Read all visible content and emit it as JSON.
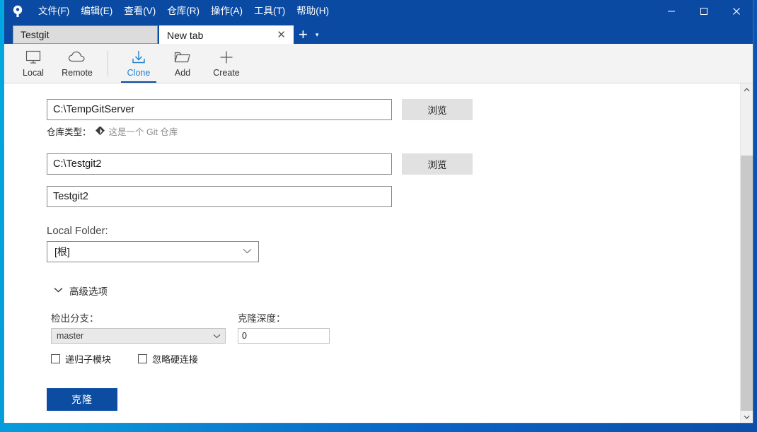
{
  "window": {
    "app_logo_icon": "smartgit-logo-icon",
    "menus": [
      {
        "label": "文件(F)",
        "name": "menu-file"
      },
      {
        "label": "编辑(E)",
        "name": "menu-edit"
      },
      {
        "label": "查看(V)",
        "name": "menu-view"
      },
      {
        "label": "仓库(R)",
        "name": "menu-repository"
      },
      {
        "label": "操作(A)",
        "name": "menu-actions"
      },
      {
        "label": "工具(T)",
        "name": "menu-tools"
      },
      {
        "label": "帮助(H)",
        "name": "menu-help"
      }
    ],
    "controls": {
      "minimize": "—",
      "maximize": "☐",
      "close": "✕"
    }
  },
  "tabs": {
    "items": [
      {
        "label": "Testgit",
        "active": false
      },
      {
        "label": "New tab",
        "active": true
      }
    ],
    "close_glyph": "✕",
    "new_tab_glyph": "+",
    "tab_menu_glyph": "▾"
  },
  "toolbar": {
    "buttons": [
      {
        "label": "Local",
        "icon": "monitor-icon",
        "selected": false
      },
      {
        "label": "Remote",
        "icon": "cloud-icon",
        "selected": false
      },
      {
        "label": "Clone",
        "icon": "download-arrow-icon",
        "selected": true
      },
      {
        "label": "Add",
        "icon": "folder-icon",
        "selected": false
      },
      {
        "label": "Create",
        "icon": "plus-icon",
        "selected": false
      }
    ]
  },
  "form": {
    "source": {
      "value": "C:\\TempGitServer",
      "placeholder": "",
      "browse_label": "浏览"
    },
    "repo_type": {
      "label": "仓库类型：",
      "icon": "git-diamond-icon",
      "hint": "这是一个 Git 仓库"
    },
    "target": {
      "value": "C:\\Testgit2",
      "placeholder": "",
      "browse_label": "浏览"
    },
    "name": {
      "value": "Testgit2",
      "placeholder": ""
    },
    "local_folder": {
      "label": "Local Folder:",
      "value": "[根]",
      "caret": "∨"
    },
    "advanced": {
      "toggle_label": "高级选项",
      "chevron": "∨",
      "checkout_branch": {
        "label": "检出分支：",
        "value": "master",
        "caret": "∨"
      },
      "clone_depth": {
        "label": "克隆深度：",
        "value": "0"
      },
      "checkboxes": [
        {
          "label": "递归子模块",
          "checked": false
        },
        {
          "label": "忽略硬连接",
          "checked": false
        }
      ]
    },
    "submit_label": "克隆"
  },
  "scrollbar": {
    "up_glyph": "∧",
    "down_glyph": "∨"
  },
  "colors": {
    "titlebar": "#0b4aa2",
    "accent": "#0c4da2",
    "selected_tool": "#1f7fd0",
    "toolbar_bg": "#f3f3f3"
  }
}
